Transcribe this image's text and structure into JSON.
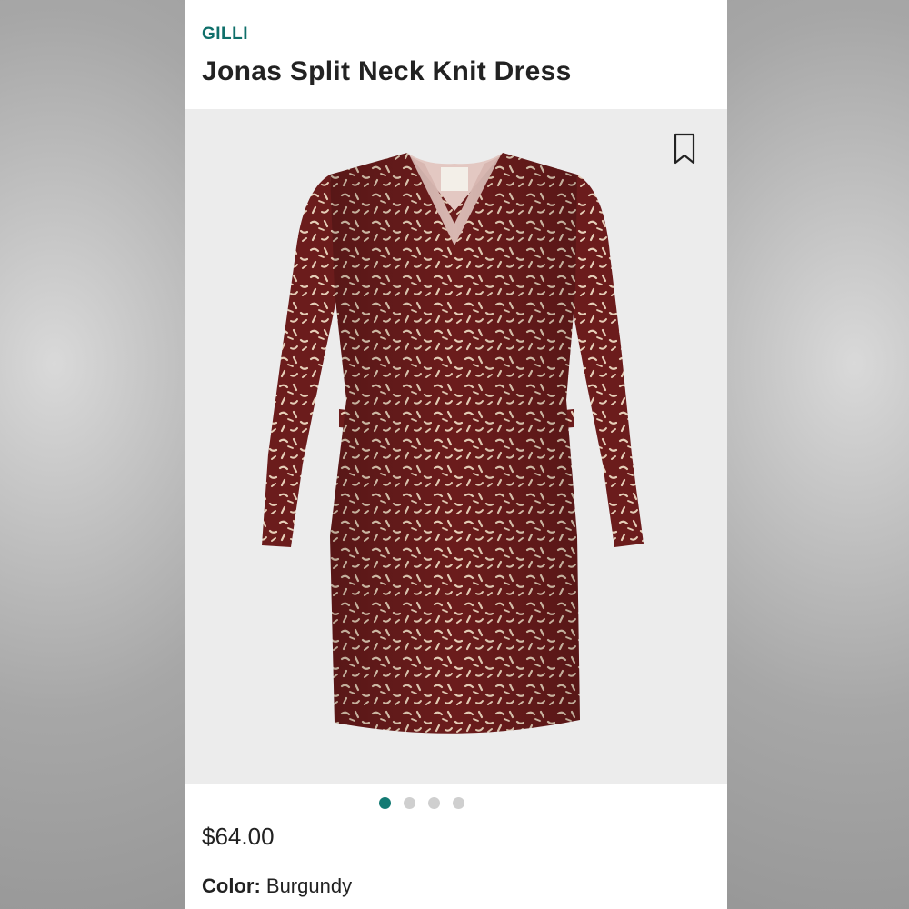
{
  "product": {
    "brand": "GILLI",
    "title": "Jonas Split Neck Knit Dress",
    "price": "$64.00",
    "color_label": "Color:",
    "color_value": "Burgundy"
  },
  "gallery": {
    "image_count": 4,
    "active_index": 0
  },
  "icons": {
    "bookmark": "bookmark-icon"
  },
  "colors": {
    "brand_teal": "#0f6f6a",
    "dot_active": "#137a73",
    "dot_inactive": "#cfcfcf",
    "dress_burgundy": "#6a1b1b",
    "pattern_cream": "#e9d3bd",
    "image_bg": "#ececec"
  }
}
